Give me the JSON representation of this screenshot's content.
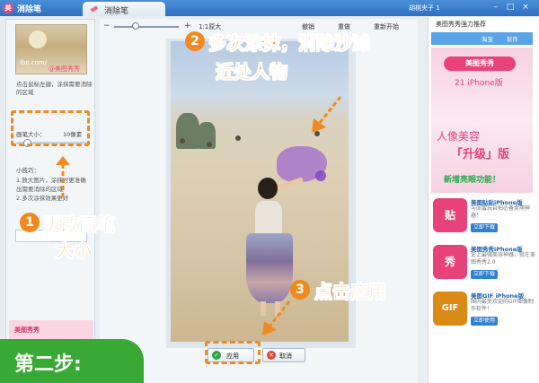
{
  "app": {
    "title": "消除笔",
    "logo_glyph": "美",
    "active_tab": "消除笔",
    "user_name": "胡桃夹子 1",
    "window_buttons": [
      "–",
      "□",
      "×"
    ]
  },
  "left_panel": {
    "thumbnail_watermark_1": "ibo.com/",
    "thumbnail_watermark_2": "@美图秀秀",
    "help_text": "点击鼠标左键，涂抹需要消除的区域",
    "brush_label": "画笔大小：",
    "brush_value": "10像素",
    "brush_level": 0.1,
    "tips_title": "小技巧：",
    "tips": [
      "1.放大图片，涂抹时更准确",
      "出需要消除的区域",
      "2.多次涂抹效果更好"
    ],
    "promo_text": "美图秀秀"
  },
  "toolbar": {
    "zoom_out_icon": "−",
    "zoom_in_icon": "+",
    "original_size": "1:1原大",
    "undo": "撤销",
    "redo": "重做",
    "restart": "重新开始"
  },
  "footer": {
    "apply_label": "应用",
    "apply_icon": "✓",
    "cancel_label": "取消",
    "cancel_icon": "✕"
  },
  "right_panel": {
    "title": "美图秀秀强力推荐",
    "tabs": [
      "",
      "淘宝",
      "软件"
    ],
    "ad": {
      "logo_text": "美图秀秀",
      "platform": "21 iPhone版",
      "line_beauty": "人像美容",
      "line_upgrade_bracket_open": "「",
      "line_upgrade": "升级",
      "line_upgrade_bracket_close": "」",
      "line_upgrade_suffix": "版",
      "line_feature": "新增亮眼功能！"
    },
    "apps": [
      {
        "icon_glyph": "贴",
        "name": "美图贴贴iPhone版",
        "desc": "与闺蜜玩自拍必备卖萌神器！",
        "button": "立即下载",
        "color": "#e8427a"
      },
      {
        "icon_glyph": "秀",
        "name": "美图秀秀iPhone版",
        "desc": "史上最强美容神器，就在美图秀秀2.0",
        "button": "立即下载",
        "color": "#e8427a"
      },
      {
        "icon_glyph": "GIF",
        "name": "美图GIF iPhone版",
        "desc": "国内最受欢迎的GIF图像制作软件！",
        "button": "立即使用",
        "color": "#d98b16"
      }
    ]
  },
  "annotations": {
    "step1_number": "1",
    "step1_text_line1": "更改画笔",
    "step1_text_line2": "大小",
    "step2_number": "2",
    "step2_text_line1": "多次涂抹，消除沙滩",
    "step2_text_line2": "近处人物",
    "step3_number": "3",
    "step3_text": "点击应用",
    "step_banner": "第二步:"
  },
  "colors": {
    "accent": "#f08a1e",
    "titlebar": "#2f6fbf",
    "banner": "#39a935",
    "paint": "#9660d2"
  }
}
